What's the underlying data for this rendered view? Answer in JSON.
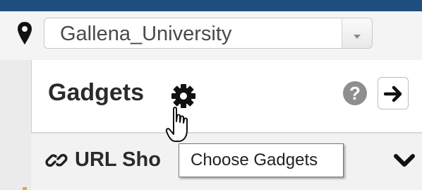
{
  "location": {
    "selected": "Gallena_University",
    "icon": "map-marker-icon"
  },
  "panel": {
    "title": "Gadgets",
    "settings_icon": "gear-icon",
    "help_icon": "help-icon",
    "help_glyph": "?",
    "next_icon": "arrow-right-icon"
  },
  "gadget_row": {
    "label": "URL Sho",
    "icon": "link-icon",
    "toggle_icon": "chevron-down-icon"
  },
  "tooltip": {
    "text": "Choose Gadgets"
  },
  "colors": {
    "top_bar": "#1d4f7e",
    "text_dark": "#2b2b2b",
    "help_gray": "#8e8e8e"
  }
}
